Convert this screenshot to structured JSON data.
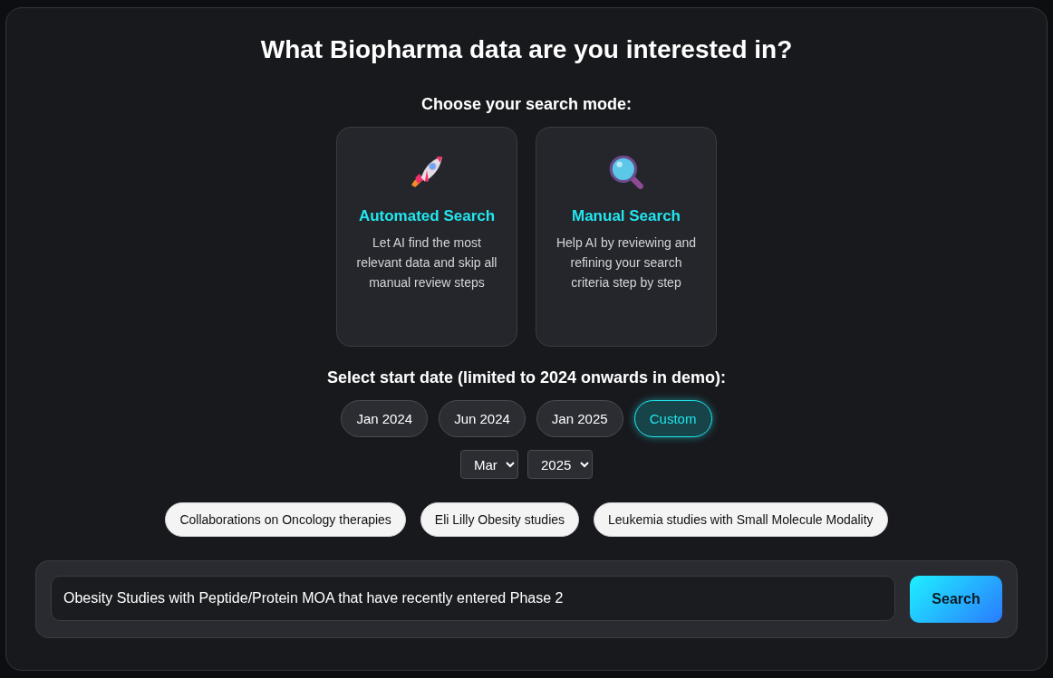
{
  "title": "What Biopharma data are you interested in?",
  "mode_heading": "Choose your search mode:",
  "modes": [
    {
      "kind": "rocket",
      "title": "Automated Search",
      "description": "Let AI find the most relevant data and skip all manual review steps"
    },
    {
      "kind": "magnifier",
      "title": "Manual Search",
      "description": "Help AI by reviewing and refining your search criteria step by step"
    }
  ],
  "date_heading": "Select start date (limited to 2024 onwards in demo):",
  "date_options": [
    {
      "label": "Jan 2024",
      "selected": false
    },
    {
      "label": "Jun 2024",
      "selected": false
    },
    {
      "label": "Jan 2025",
      "selected": false
    },
    {
      "label": "Custom",
      "selected": true
    }
  ],
  "month_select": {
    "value": "Mar"
  },
  "year_select": {
    "value": "2025"
  },
  "suggestions": [
    "Collaborations on Oncology therapies",
    "Eli Lilly Obesity studies",
    "Leukemia studies with Small Molecule Modality"
  ],
  "query": {
    "value": "Obesity Studies with Peptide/Protein MOA that have recently entered Phase 2"
  },
  "search_button": "Search"
}
